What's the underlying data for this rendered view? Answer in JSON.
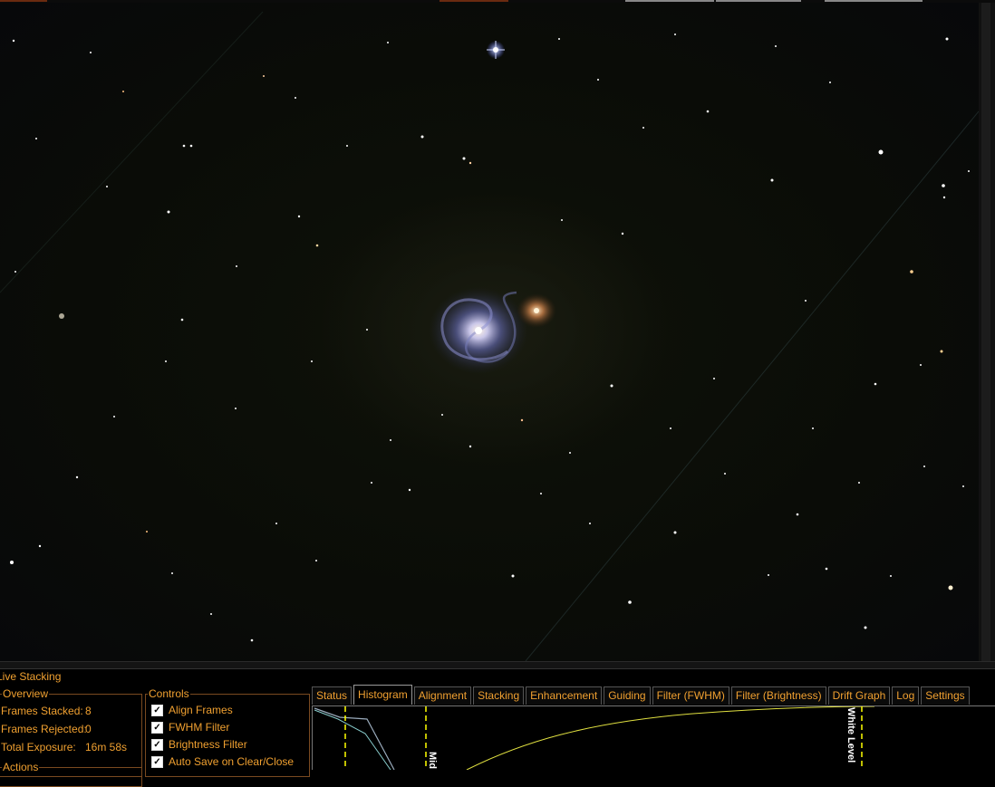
{
  "window": {
    "panel_title": "Live Stacking"
  },
  "overview": {
    "legend": "Overview",
    "stats": [
      {
        "label": "Frames Stacked:",
        "value": "8"
      },
      {
        "label": "Frames Rejected:",
        "value": "0"
      },
      {
        "label": "Total Exposure:",
        "value": "16m 58s"
      }
    ]
  },
  "controls": {
    "legend": "Controls",
    "items": [
      {
        "label": "Align Frames",
        "checked": true
      },
      {
        "label": "FWHM Filter",
        "checked": true
      },
      {
        "label": "Brightness Filter",
        "checked": true
      },
      {
        "label": "Auto Save on Clear/Close",
        "checked": true
      }
    ]
  },
  "actions": {
    "legend": "Actions"
  },
  "tabs": [
    {
      "label": "Status",
      "active": false
    },
    {
      "label": "Histogram",
      "active": true
    },
    {
      "label": "Alignment",
      "active": false
    },
    {
      "label": "Stacking",
      "active": false
    },
    {
      "label": "Enhancement",
      "active": false
    },
    {
      "label": "Guiding",
      "active": false
    },
    {
      "label": "Filter (FWHM)",
      "active": false
    },
    {
      "label": "Filter (Brightness)",
      "active": false
    },
    {
      "label": "Drift Graph",
      "active": false
    },
    {
      "label": "Log",
      "active": false
    },
    {
      "label": "Settings",
      "active": false
    }
  ],
  "histogram": {
    "mid_label": "Mid",
    "white_label": "White Level",
    "curve_color": "#e0e040",
    "marker_color": "#ffff00"
  },
  "colors": {
    "accent": "#f0a030",
    "background": "#000000"
  }
}
